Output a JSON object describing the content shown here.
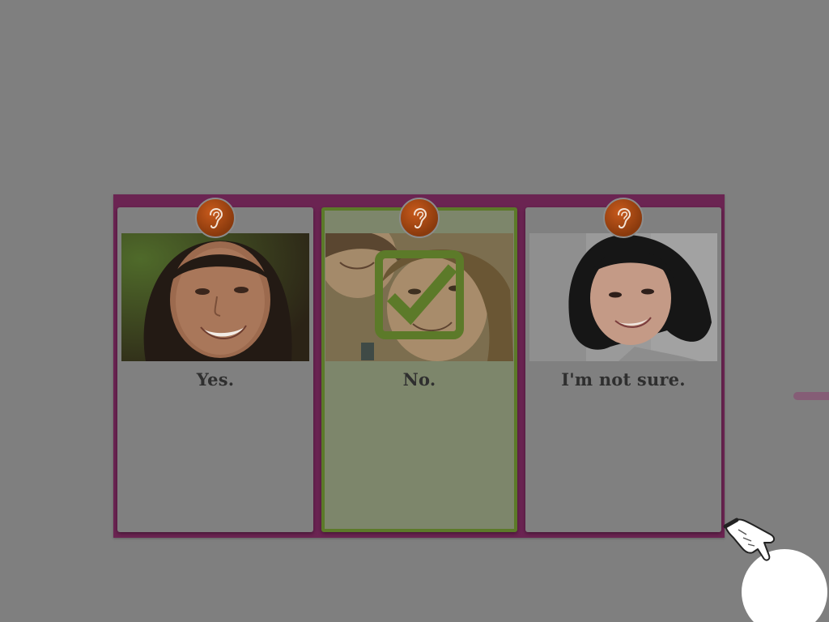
{
  "answer_panel": {
    "background_color": "#6b2452",
    "options": [
      {
        "label": "Yes.",
        "audio_icon": "ear-icon",
        "selected": false
      },
      {
        "label": "No.",
        "audio_icon": "ear-icon",
        "selected": true
      },
      {
        "label": "I'm not sure.",
        "audio_icon": "ear-icon",
        "selected": false
      }
    ]
  },
  "selection_indicator": {
    "icon": "checkmark-icon",
    "color": "#5c7a29"
  },
  "pointer": {
    "icon": "hand-pointer-icon"
  },
  "touch_indicator": {
    "color": "#ffffff"
  }
}
